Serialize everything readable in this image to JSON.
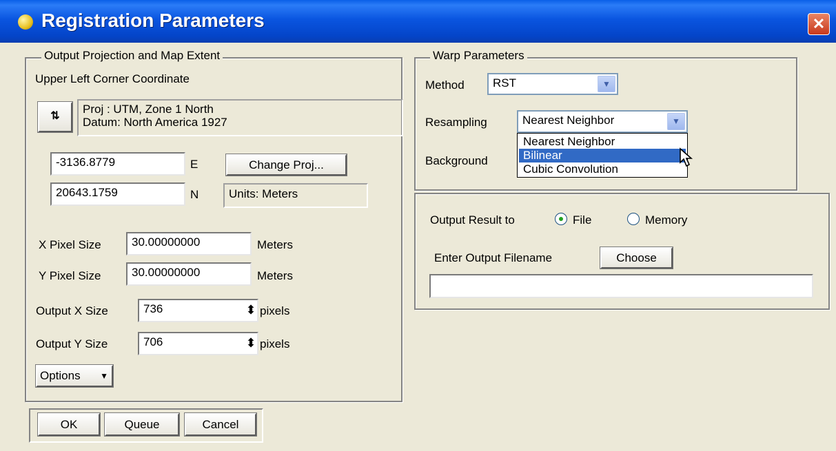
{
  "window": {
    "title": "Registration Parameters",
    "close_glyph": "✕"
  },
  "projection": {
    "group_label": "Output Projection and Map Extent",
    "corner_label": "Upper Left Corner Coordinate",
    "proj_line1": "Proj : UTM, Zone 1 North",
    "proj_line2": "Datum: North America 1927",
    "easting_value": "-3136.8779",
    "easting_unit": "E",
    "northing_value": "20643.1759",
    "northing_unit": "N",
    "change_proj_label": "Change Proj...",
    "units_text": "Units: Meters",
    "x_pixel_label": "X Pixel Size",
    "x_pixel_value": "30.00000000",
    "x_pixel_unit": "Meters",
    "y_pixel_label": "Y Pixel Size",
    "y_pixel_value": "30.00000000",
    "y_pixel_unit": "Meters",
    "out_x_label": "Output X Size",
    "out_x_value": "736",
    "out_x_unit": "pixels",
    "out_y_label": "Output Y Size",
    "out_y_value": "706",
    "out_y_unit": "pixels",
    "options_label": "Options"
  },
  "warp": {
    "group_label": "Warp Parameters",
    "method_label": "Method",
    "method_value": "RST",
    "resampling_label": "Resampling",
    "resampling_value": "Nearest Neighbor",
    "background_label": "Background",
    "resampling_options": [
      "Nearest Neighbor",
      "Bilinear",
      "Cubic Convolution"
    ],
    "highlighted_option": "Bilinear"
  },
  "output": {
    "result_label": "Output Result to",
    "file_label": "File",
    "memory_label": "Memory",
    "selected": "File",
    "filename_label": "Enter Output Filename",
    "choose_label": "Choose",
    "filename_value": ""
  },
  "buttons": {
    "ok": "OK",
    "queue": "Queue",
    "cancel": "Cancel"
  },
  "colors": {
    "title_bar": "#0a55e0",
    "dialog_bg": "#ece9d8",
    "highlight": "#316ac5",
    "close": "#c8381c"
  },
  "icons": {
    "title": "app-icon",
    "close": "close-icon",
    "swap": "swap-arrows-icon",
    "dropdown": "chevron-down-icon",
    "spinner": "spinner-arrows-icon",
    "cursor": "mouse-pointer-icon"
  }
}
